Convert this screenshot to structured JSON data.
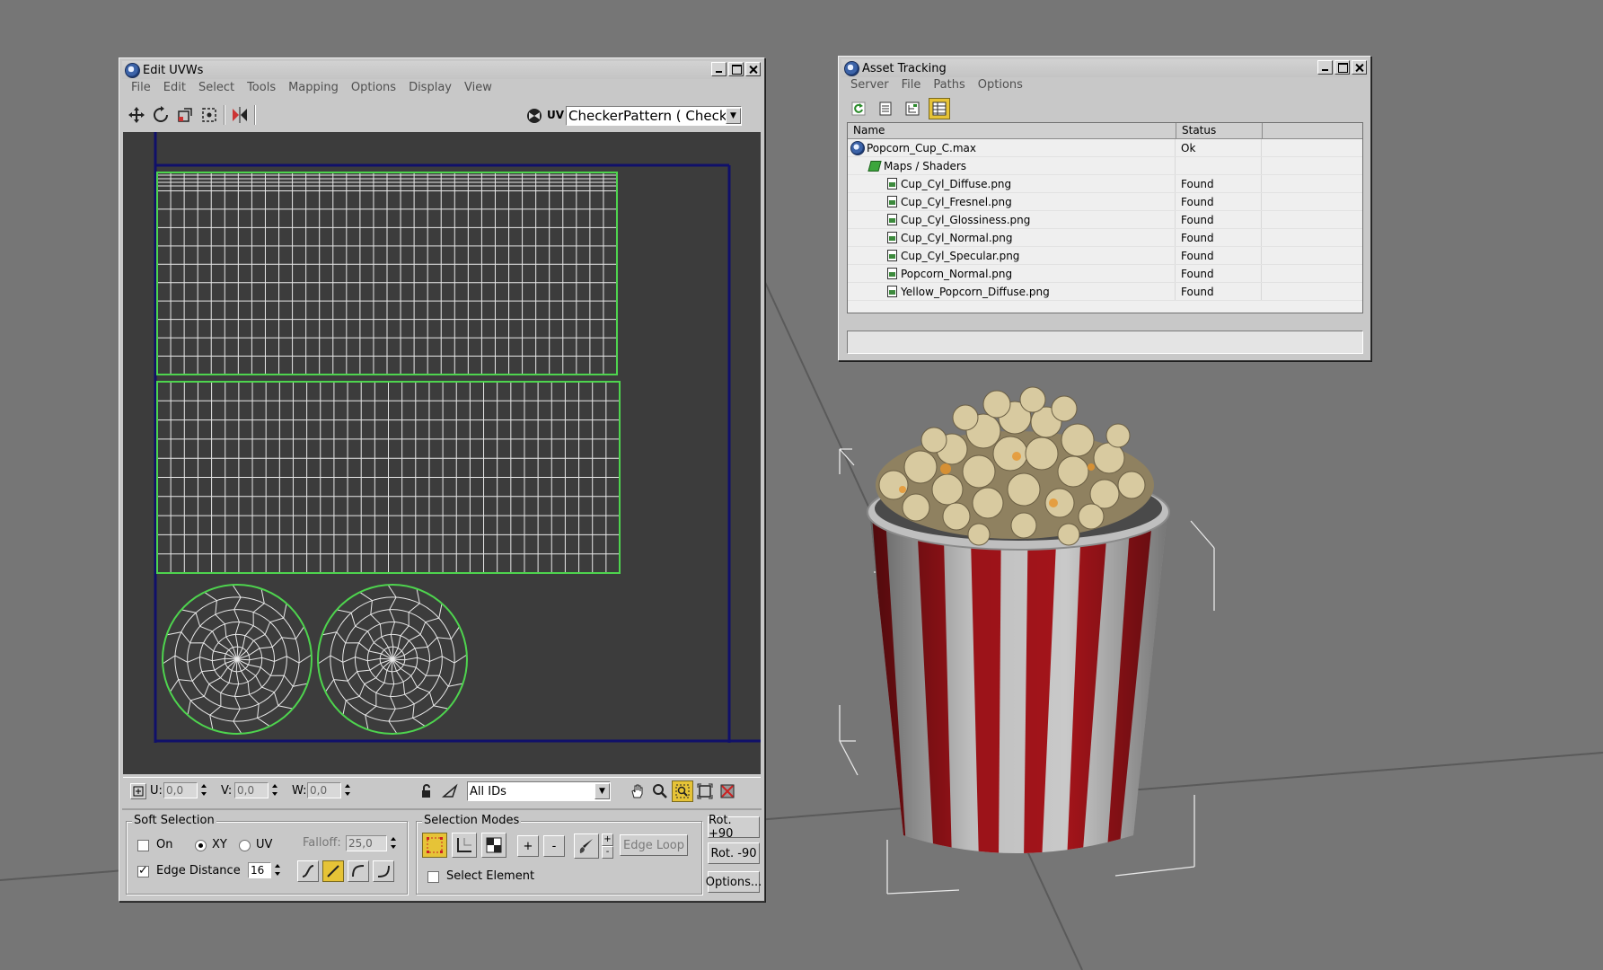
{
  "colors": {
    "viewport_bg": "#767676",
    "uv_canvas_bg": "#3c3c3c",
    "uv_frame": "#10106a",
    "uv_select": "#4ed44e",
    "cup_red": "#a3141a",
    "cup_white": "#c9c9c9",
    "popcorn": "#c8b88e",
    "active_tool": "#e6c337"
  },
  "edit_uvws": {
    "title": "Edit UVWs",
    "menu": [
      "File",
      "Edit",
      "Select",
      "Tools",
      "Mapping",
      "Options",
      "Display",
      "View"
    ],
    "toolbar": {
      "tools": [
        "move-icon",
        "rotate-icon",
        "scale-icon",
        "freeform-icon",
        "mirror-icon"
      ],
      "uv_label": "UV",
      "map_dropdown": "CheckerPattern  ( Checke"
    },
    "bottom_bar": {
      "u_label": "U:",
      "u_value": "0,0",
      "v_label": "V:",
      "v_value": "0,0",
      "w_label": "W:",
      "w_value": "0,0",
      "ids_dropdown": "All IDs"
    },
    "soft_selection": {
      "title": "Soft Selection",
      "on_label": "On",
      "xy_label": "XY",
      "uv_label": "UV",
      "falloff_label": "Falloff:",
      "falloff_value": "25,0",
      "edge_distance_label": "Edge Distance",
      "edge_distance_value": "16"
    },
    "selection_modes": {
      "title": "Selection Modes",
      "plus_label": "+",
      "minus_label": "-",
      "edge_loop_label": "Edge Loop",
      "select_element_label": "Select Element"
    },
    "right_buttons": {
      "rot_plus": "Rot. +90",
      "rot_minus": "Rot. -90",
      "options": "Options..."
    }
  },
  "asset_tracking": {
    "title": "Asset Tracking",
    "menu": [
      "Server",
      "File",
      "Paths",
      "Options"
    ],
    "columns": [
      "Name",
      "Status"
    ],
    "root": {
      "name": "Popcorn_Cup_C.max",
      "status": "Ok"
    },
    "folder": {
      "name": "Maps / Shaders"
    },
    "files": [
      {
        "name": "Cup_Cyl_Diffuse.png",
        "status": "Found"
      },
      {
        "name": "Cup_Cyl_Fresnel.png",
        "status": "Found"
      },
      {
        "name": "Cup_Cyl_Glossiness.png",
        "status": "Found"
      },
      {
        "name": "Cup_Cyl_Normal.png",
        "status": "Found"
      },
      {
        "name": "Cup_Cyl_Specular.png",
        "status": "Found"
      },
      {
        "name": "Popcorn_Normal.png",
        "status": "Found"
      },
      {
        "name": "Yellow_Popcorn_Diffuse.png",
        "status": "Found"
      }
    ]
  }
}
